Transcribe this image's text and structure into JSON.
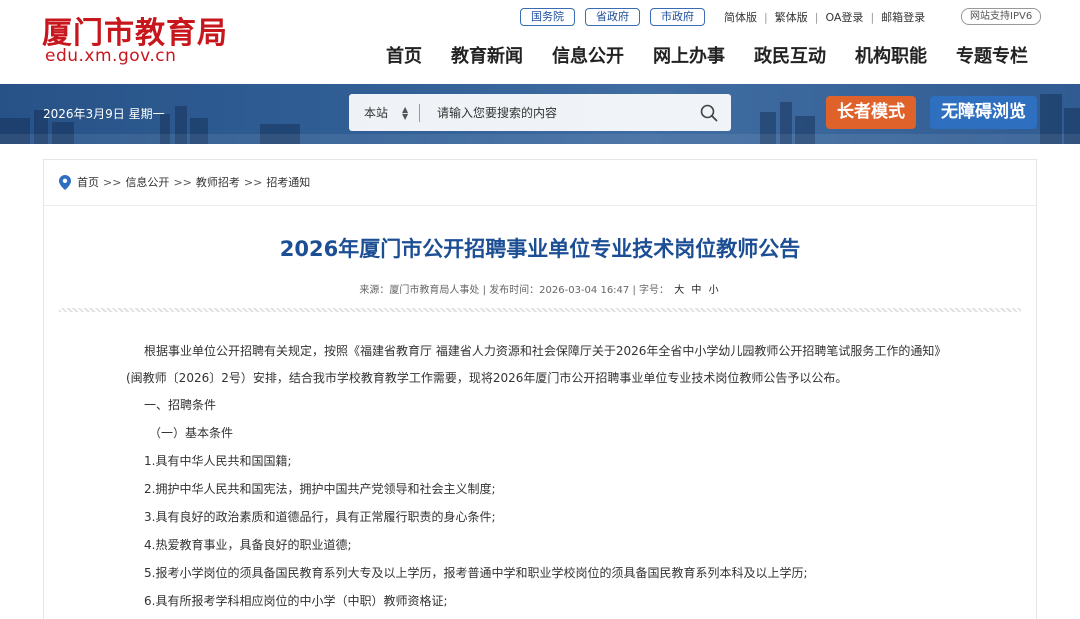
{
  "header": {
    "logo_title": "厦门市教育局",
    "logo_url": "edu.xm.gov.cn",
    "top_links": [
      "国务院",
      "省政府",
      "市政府"
    ],
    "util_links": [
      "简体版",
      "繁体版",
      "OA登录",
      "邮箱登录"
    ],
    "ipv6": "网站支持IPV6",
    "nav": [
      "首页",
      "教育新闻",
      "信息公开",
      "网上办事",
      "政民互动",
      "机构职能",
      "专题专栏"
    ]
  },
  "banner": {
    "date": "2026年3月9日 星期一",
    "search": {
      "scope": "本站",
      "placeholder": "请输入您要搜索的内容"
    },
    "elder_mode": "长者模式",
    "barrier_free": "无障碍浏览"
  },
  "breadcrumb": {
    "items": [
      "首页",
      "信息公开",
      "教师招考",
      "招考通知"
    ],
    "separator": ">>"
  },
  "article": {
    "title": "2026年厦门市公开招聘事业单位专业技术岗位教师公告",
    "meta": {
      "source_label": "来源：",
      "source": "厦门市教育局人事处",
      "pub_label": "发布时间：",
      "pub_time": "2026-03-04 16:47",
      "size_label": "字号：",
      "sizes": [
        "大",
        "中",
        "小"
      ]
    },
    "paragraphs": [
      "根据事业单位公开招聘有关规定，按照《福建省教育厅 福建省人力资源和社会保障厅关于2026年全省中小学幼儿园教师公开招聘笔试服务工作的通知》",
      "(闽教师〔2026〕2号）安排，结合我市学校教育教学工作需要，现将2026年厦门市公开招聘事业单位专业技术岗位教师公告予以公布。",
      "一、招聘条件",
      "（一）基本条件",
      "1.具有中华人民共和国国籍;",
      "2.拥护中华人民共和国宪法，拥护中国共产党领导和社会主义制度;",
      "3.具有良好的政治素质和道德品行，具有正常履行职责的身心条件;",
      "4.热爱教育事业，具备良好的职业道德;",
      "5.报考小学岗位的须具备国民教育系列大专及以上学历，报考普通中学和职业学校岗位的须具备国民教育系列本科及以上学历;",
      "6.具有所报考学科相应岗位的中小学（中职）教师资格证;"
    ]
  },
  "colors": {
    "brand_red": "#c8161d",
    "title_blue": "#1c4e94",
    "elder_orange": "#e0622b",
    "barrier_blue": "#2f6fc0",
    "banner_blue": "#3b6ea8"
  },
  "icons": {
    "search": "search-icon",
    "location": "location-pin-icon",
    "scope_toggle": "updown-arrow-icon"
  }
}
